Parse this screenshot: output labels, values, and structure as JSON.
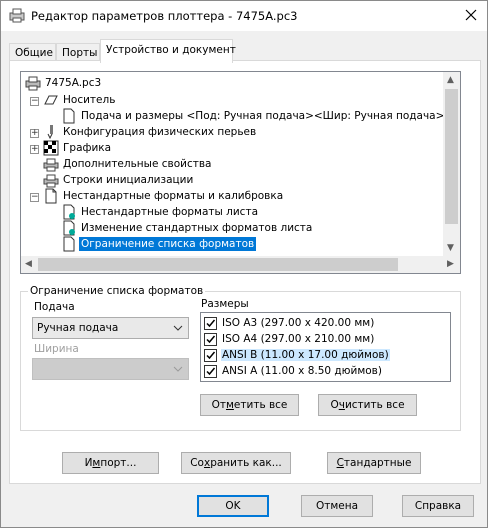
{
  "window": {
    "title": "Редактор параметров плоттера - 7475A.pc3"
  },
  "tabs": [
    {
      "label": "Общие"
    },
    {
      "label": "Порты"
    },
    {
      "label": "Устройство и документ"
    }
  ],
  "tree": {
    "items": [
      {
        "label": "7475A.pc3",
        "icon": "plotter-icon"
      },
      {
        "label": "Носитель",
        "icon": "media-icon"
      },
      {
        "label": "Подача и размеры <Под:  Ручная подача><Шир: Ручная подача><Ра:",
        "icon": "document-icon"
      },
      {
        "label": "Конфигурация физических перьев",
        "icon": "pen-icon"
      },
      {
        "label": "Графика",
        "icon": "graphics-icon"
      },
      {
        "label": "Дополнительные свойства",
        "icon": "properties-icon"
      },
      {
        "label": "Строки инициализации",
        "icon": "strings-icon"
      },
      {
        "label": "Нестандартные форматы и калибровка",
        "icon": "document-icon"
      },
      {
        "label": "Нестандартные форматы листа",
        "icon": "custom-sheet-icon"
      },
      {
        "label": "Изменение стандартных форматов листа",
        "icon": "modify-sheet-icon"
      },
      {
        "label": "Ограничение списка форматов",
        "icon": "document-icon"
      }
    ]
  },
  "group": {
    "legend": "Ограничение списка форматов"
  },
  "source": {
    "label": "Подача",
    "value": "Ручная подача"
  },
  "width_field": {
    "label": "Ширина",
    "value": ""
  },
  "sizes": {
    "label": "Размеры",
    "items": [
      {
        "label": "ISO A3 (297.00 x 420.00 мм)",
        "checked": true
      },
      {
        "label": "ISO A4 (297.00 x 210.00 мм)",
        "checked": true
      },
      {
        "label": "ANSI B (11.00 x 17.00 дюймов)",
        "checked": true
      },
      {
        "label": "ANSI A (11.00 x 8.50 дюймов)",
        "checked": true
      }
    ]
  },
  "buttons": {
    "check_all_pre": "От",
    "check_all_u": "м",
    "check_all_post": "етить все",
    "clear_all_pre": "О",
    "clear_all_u": "ч",
    "clear_all_post": "истить все",
    "import_pre": "И",
    "import_u": "м",
    "import_post": "порт...",
    "save_as_pre": "Со",
    "save_as_u": "х",
    "save_as_post": "ранить как...",
    "defaults_pre": "",
    "defaults_u": "С",
    "defaults_post": "тандартные",
    "ok": "OK",
    "cancel": "Отмена",
    "help": "Справка"
  },
  "colors": {
    "accent": "#0078d7"
  }
}
